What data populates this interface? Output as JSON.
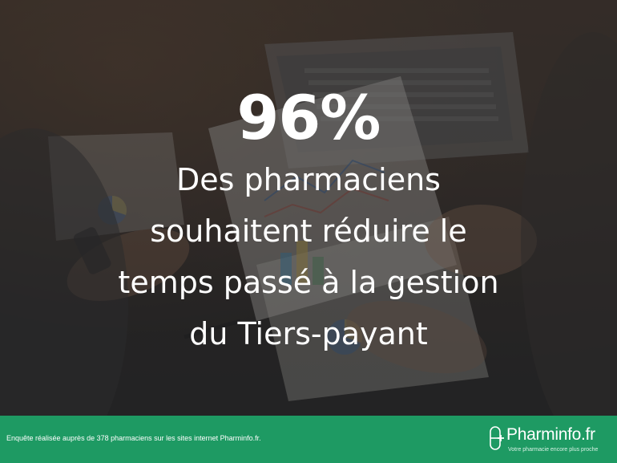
{
  "headline": {
    "stat": "96%",
    "lines": [
      "Des pharmaciens",
      "souhaitent réduire le",
      "temps passé à la gestion",
      "du Tiers-payant"
    ]
  },
  "footer": {
    "note": "Enquête réalisée auprès de 378 pharmaciens sur les sites internet Pharminfo.fr.",
    "brand_name": "Pharminfo.fr",
    "brand_tagline": "Votre pharmacie encore plus proche"
  },
  "colors": {
    "footer_bg": "#1e9a63",
    "text": "#ffffff",
    "overlay": "#1c1c1e"
  },
  "icons": {
    "brand_logo": "pharmacy-cross-capsule-icon"
  }
}
